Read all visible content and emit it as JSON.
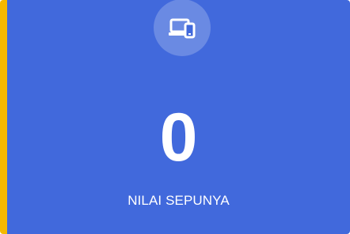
{
  "card": {
    "icon": "devices-icon",
    "value": "0",
    "label": "NILAI SEPUNYA",
    "colors": {
      "background": "#4169dc",
      "accent_border": "#f5b800",
      "text": "#ffffff"
    }
  }
}
